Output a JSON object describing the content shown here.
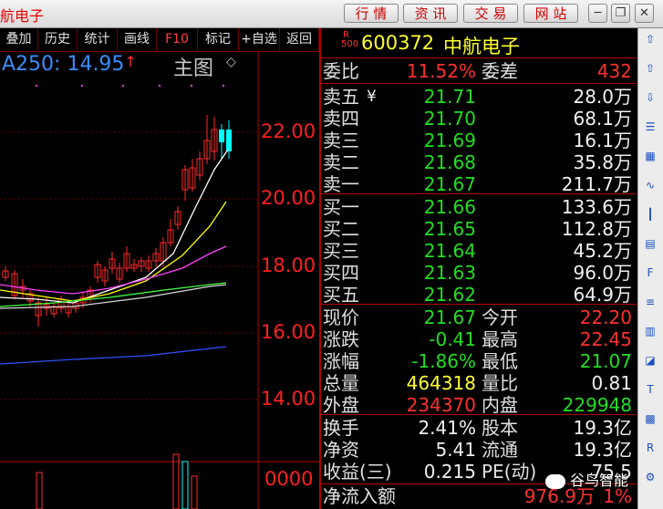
{
  "window": {
    "title": "航电子"
  },
  "nav": {
    "hangqing": "行 情",
    "zixun": "资 讯",
    "jiaoyi": "交 易",
    "wangzhan": "网 站"
  },
  "toolbar": [
    "叠加",
    "历史",
    "统计",
    "画线",
    "F10",
    "标记",
    "+自选",
    "返回"
  ],
  "chart": {
    "ma_label": "A250: 14.95",
    "ma_arrow": "↑",
    "panel_title": "主图",
    "panel_mark": "◇",
    "y_ticks": [
      "22.00",
      "20.00",
      "18.00",
      "16.00",
      "14.00"
    ],
    "vol_tick": "0000",
    "colors": {
      "up": "#ff2a2a",
      "down": "#00ffff",
      "ma5": "#ffffff",
      "ma10": "#ffff00",
      "ma20": "#ff40ff",
      "ma60": "#40ff40",
      "ma250": "#3050ff"
    }
  },
  "quote": {
    "r_badge": "R",
    "r_num": "500",
    "code": "600372",
    "name": "中航电子",
    "weibi_label": "委比",
    "weibi": "11.52%",
    "weicha_label": "委差",
    "weicha": "432",
    "asks": [
      {
        "label": "卖五",
        "mark": "¥",
        "price": "21.71",
        "vol": "28.0万"
      },
      {
        "label": "卖四",
        "mark": "",
        "price": "21.70",
        "vol": "68.1万"
      },
      {
        "label": "卖三",
        "mark": "",
        "price": "21.69",
        "vol": "16.1万"
      },
      {
        "label": "卖二",
        "mark": "",
        "price": "21.68",
        "vol": "35.8万"
      },
      {
        "label": "卖一",
        "mark": "",
        "price": "21.67",
        "vol": "211.7万"
      }
    ],
    "bids": [
      {
        "label": "买一",
        "price": "21.66",
        "vol": "133.6万"
      },
      {
        "label": "买二",
        "price": "21.65",
        "vol": "112.8万"
      },
      {
        "label": "买三",
        "price": "21.64",
        "vol": "45.2万"
      },
      {
        "label": "买四",
        "price": "21.63",
        "vol": "96.0万"
      },
      {
        "label": "买五",
        "price": "21.62",
        "vol": "64.9万"
      }
    ],
    "stats": [
      {
        "l1": "现价",
        "v1": "21.67",
        "l2": "今开",
        "v2": "22.20"
      },
      {
        "l1": "涨跌",
        "v1": "-0.41",
        "l2": "最高",
        "v2": "22.45"
      },
      {
        "l1": "涨幅",
        "v1": "-1.86%",
        "l2": "最低",
        "v2": "21.07"
      },
      {
        "l1": "总量",
        "v1": "464318",
        "l2": "量比",
        "v2": "0.81"
      },
      {
        "l1": "外盘",
        "v1": "234370",
        "l2": "内盘",
        "v2": "229948"
      }
    ],
    "fin": [
      {
        "l1": "换手",
        "v1": "2.41%",
        "l2": "股本",
        "v2": "19.3亿"
      },
      {
        "l1": "净资",
        "v1": "5.41",
        "l2": "流通",
        "v2": "19.3亿"
      },
      {
        "l1": "收益(三)",
        "v1": "0.215",
        "l2": "PE(动)",
        "v2": "75.5"
      }
    ],
    "netflow_label": "净流入额",
    "netflow": "976.9万",
    "netflow_pct": "1%"
  },
  "watermark": "谷鸟智能",
  "side_icons": [
    "up-arrow-icon",
    "up-arrow-icon",
    "down-arrow-icon",
    "list-icon",
    "grid-icon",
    "line-chart-icon",
    "candle-icon",
    "table-icon",
    "f10-icon",
    "doc-icon",
    "stats-icon",
    "chart-icon",
    "tx-icon",
    "mosaic-icon",
    "rsi-icon",
    "settings-icon"
  ]
}
